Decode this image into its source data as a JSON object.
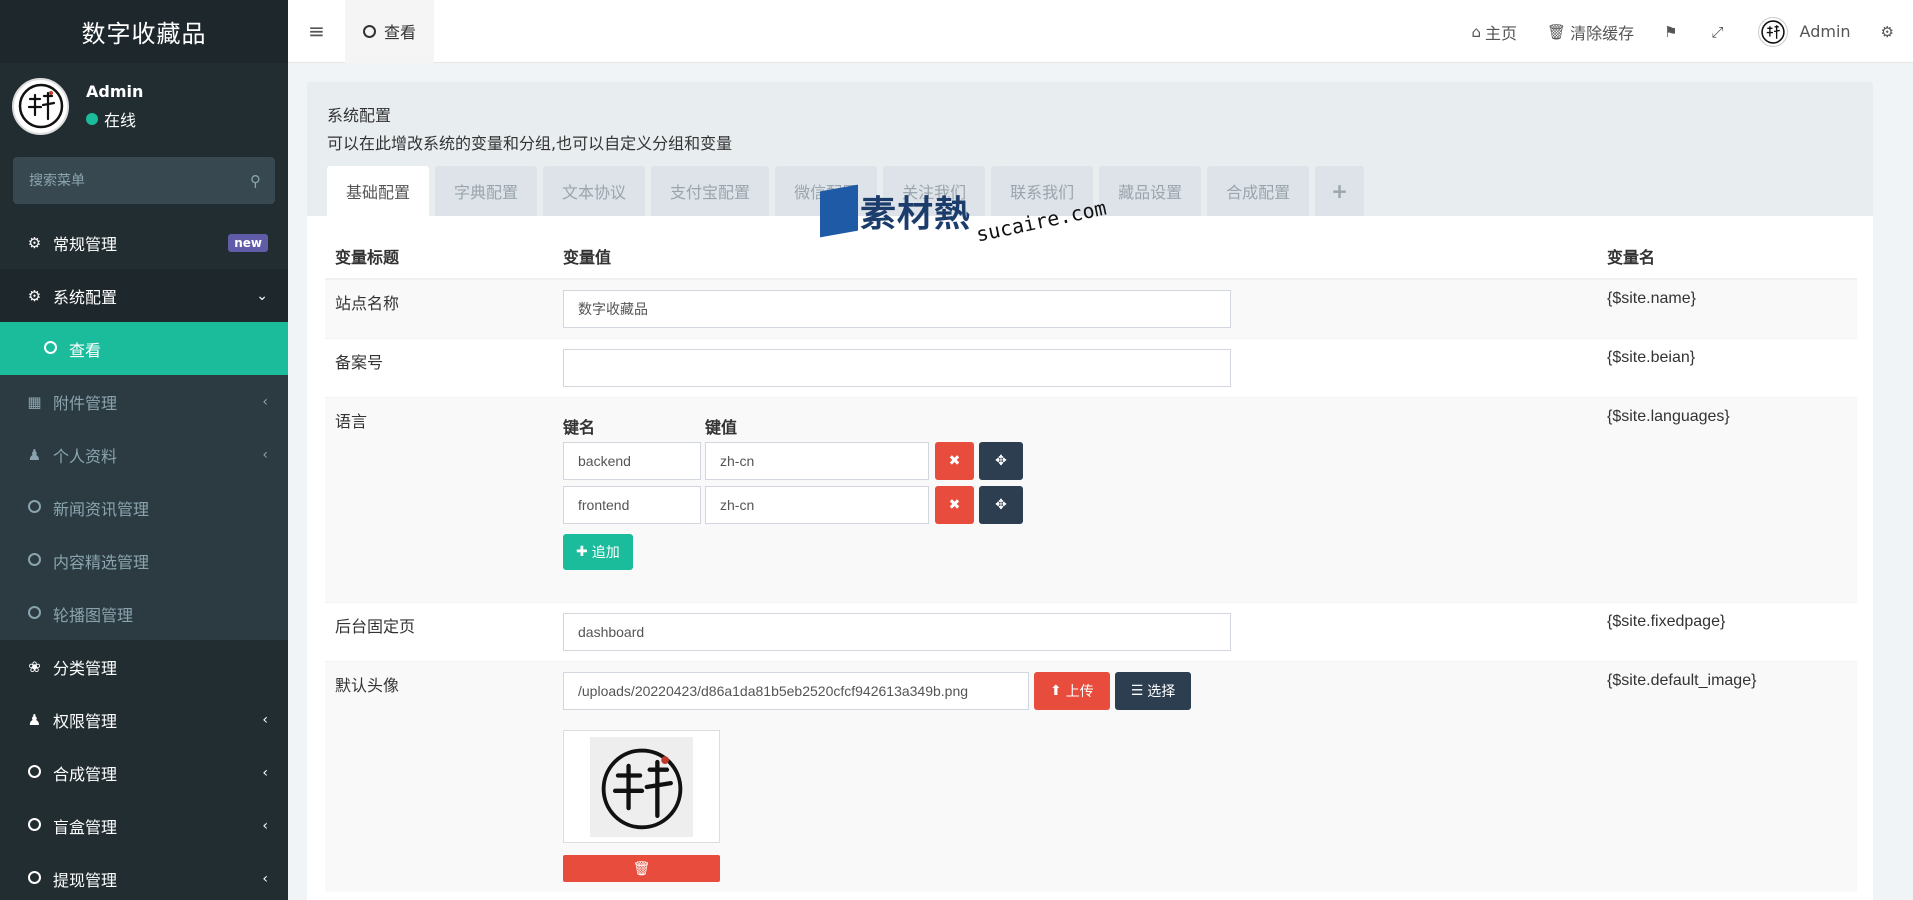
{
  "sidebar": {
    "brand": "数字收藏品",
    "user": {
      "name": "Admin",
      "status": "在线"
    },
    "search_placeholder": "搜索菜单",
    "items": [
      {
        "label": "常规管理",
        "icon": "cogs-icon",
        "badge": "new"
      },
      {
        "label": "系统配置",
        "icon": "gear-icon"
      },
      {
        "label": "查看",
        "icon": "circle-icon"
      },
      {
        "label": "附件管理",
        "icon": "file-image-icon"
      },
      {
        "label": "个人资料",
        "icon": "user-icon"
      },
      {
        "label": "新闻资讯管理",
        "icon": "circle-icon"
      },
      {
        "label": "内容精选管理",
        "icon": "circle-icon"
      },
      {
        "label": "轮播图管理",
        "icon": "circle-icon"
      },
      {
        "label": "分类管理",
        "icon": "leaf-icon"
      },
      {
        "label": "权限管理",
        "icon": "group-icon"
      },
      {
        "label": "合成管理",
        "icon": "circle-icon"
      },
      {
        "label": "盲盒管理",
        "icon": "circle-icon"
      },
      {
        "label": "提现管理",
        "icon": "circle-icon"
      }
    ]
  },
  "topbar": {
    "tab_label": "查看",
    "home": "主页",
    "clear_cache": "清除缓存",
    "user_name": "Admin"
  },
  "panel": {
    "title": "系统配置",
    "subtitle": "可以在此增改系统的变量和分组,也可以自定义分组和变量",
    "tabs": [
      "基础配置",
      "字典配置",
      "文本协议",
      "支付宝配置",
      "微信配置",
      "关注我们",
      "联系我们",
      "藏品设置",
      "合成配置",
      "+"
    ]
  },
  "table": {
    "headers": {
      "title": "变量标题",
      "value": "变量值",
      "name": "变量名"
    },
    "rows": {
      "site_name": {
        "title": "站点名称",
        "value": "数字收藏品",
        "var": "{$site.name}"
      },
      "beian": {
        "title": "备案号",
        "value": "",
        "var": "{$site.beian}"
      },
      "languages": {
        "title": "语言",
        "var": "{$site.languages}",
        "key_header": "键名",
        "value_header": "键值",
        "pairs": [
          {
            "key": "backend",
            "value": "zh-cn"
          },
          {
            "key": "frontend",
            "value": "zh-cn"
          }
        ],
        "add_label": "追加"
      },
      "fixedpage": {
        "title": "后台固定页",
        "value": "dashboard",
        "var": "{$site.fixedpage}"
      },
      "default_image": {
        "title": "默认头像",
        "value": "/uploads/20220423/d86a1da81b5eb2520cfcf942613a349b.png",
        "var": "{$site.default_image}",
        "upload_label": "上传",
        "select_label": "选择"
      }
    }
  },
  "watermark": {
    "cn": "素材熱",
    "en": "sucaire.com"
  }
}
